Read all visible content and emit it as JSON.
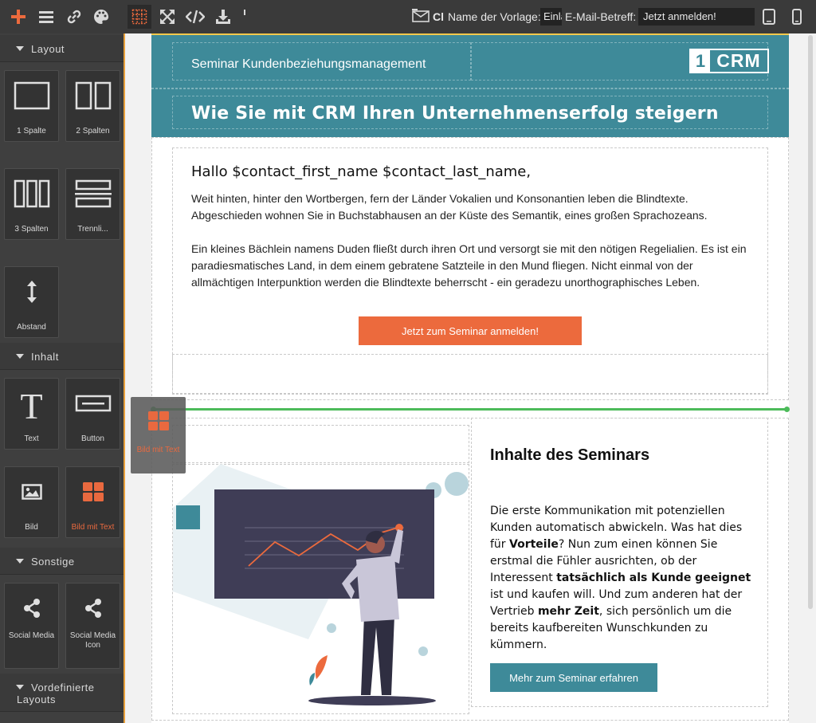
{
  "toolbar": {
    "template_name_label": "Name der Vorlage:",
    "template_name_value": "Einla",
    "email_subject_label": "E-Mail-Betreff:",
    "email_subject_value": "Jetzt anmelden!",
    "envelope_text": "Cl",
    "icons": [
      "plus-icon",
      "menu-icon",
      "link-icon",
      "palette-icon",
      "grid-icon",
      "fullscreen-icon",
      "code-icon",
      "download-icon",
      "envelope-icon",
      "desktop-icon",
      "mobile-icon"
    ]
  },
  "panel": {
    "sections": [
      {
        "label": "Layout"
      },
      {
        "label": "Inhalt"
      },
      {
        "label": "Sonstige"
      },
      {
        "label": "Vordefinierte Layouts"
      }
    ],
    "blocks": {
      "one_col": "1 Spalte",
      "two_col": "2 Spalten",
      "three_col": "3 Spalten",
      "divider": "Trennli...",
      "spacer": "Abstand",
      "text": "Text",
      "button": "Button",
      "image": "Bild",
      "image_text": "Bild mit Text",
      "social_media": "Social Media",
      "social_media_icon": "Social Media Icon"
    }
  },
  "drag_ghost": {
    "label": "Bild mit Text"
  },
  "email": {
    "seminar_title": "Seminar Kundenbeziehungsmanagement",
    "logo_one": "1",
    "logo_crm": "CRM",
    "headline": "Wie Sie mit CRM Ihren Unternehmenserfolg steigern",
    "greeting": "Hallo $contact_first_name $contact_last_name,",
    "body1": "Weit hinten, hinter den Wortbergen, fern der Länder Vokalien und Konsonantien leben die Blindtexte. Abgeschieden wohnen Sie in Buchstabhausen an der Küste des Semantik, eines großen Sprachozeans.",
    "body2": "Ein kleines Bächlein namens Duden fließt durch ihren Ort und versorgt sie mit den nötigen Regelialien. Es ist ein paradiesmatisches Land, in dem einem gebratene Satzteile in den Mund fliegen. Nicht einmal von der allmächtigen Interpunktion werden die Blindtexte beherrscht - ein geradezu unorthographisches Leben.",
    "cta1": "Jetzt zum Seminar anmelden!",
    "sec2_title": "Inhalte des Seminars",
    "sec2_text": {
      "p1": "Die erste Kommunikation mit potenziellen Kunden automatisch abwickeln. Was hat dies für ",
      "b1": "Vorteile",
      "p2": "? Nun zum einen können Sie erstmal die Fühler ausrichten, ob der Interessent ",
      "b2": "tatsächlich als Kunde geeignet",
      "p3": " ist und kaufen will. Und zum anderen hat der Vertrieb ",
      "b3": "mehr Zeit",
      "p4": ", sich persönlich um die bereits kaufbereiten Wunschkunden zu kümmern."
    },
    "cta2": "Mehr zum Seminar erfahren"
  },
  "colors": {
    "header_teal": "#3e8a99",
    "accent_orange": "#ec6a3d",
    "drop_green": "#4cbb5a",
    "panel_dark": "#3f3f3f"
  }
}
